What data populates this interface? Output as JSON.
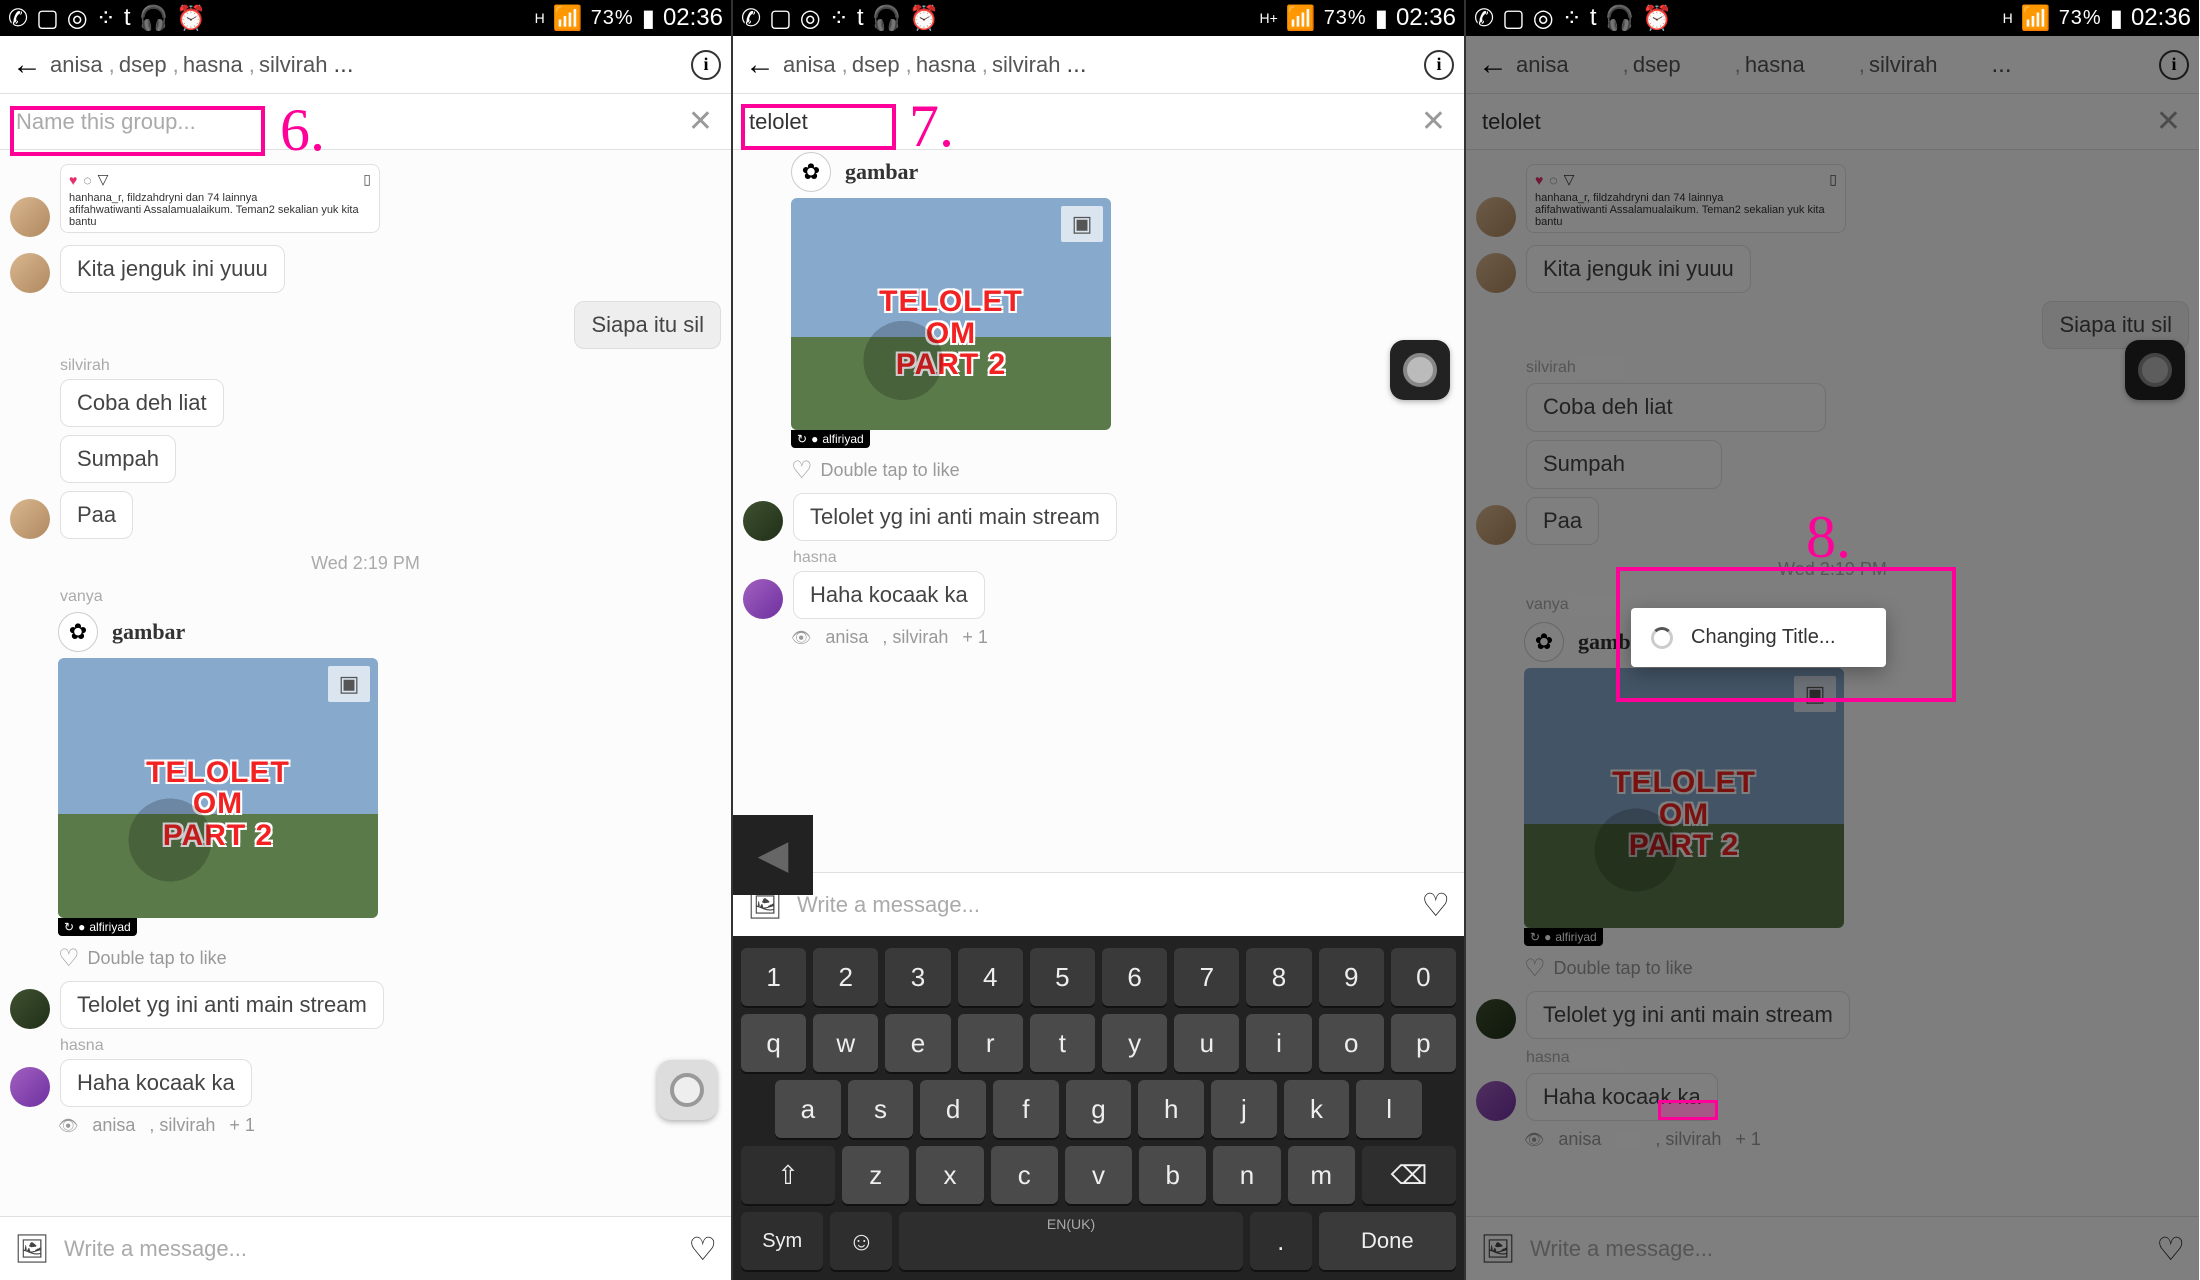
{
  "status_bar": {
    "net_label_h": "H",
    "net_label_hplus": "H+",
    "battery_pct": "73%",
    "time": "02:36"
  },
  "header": {
    "participants": [
      "anisa",
      "dsep",
      "hasna",
      "silvirah"
    ],
    "ellipsis": "..."
  },
  "groupname": {
    "placeholder": "Name this group...",
    "value_7": "telolet",
    "value_8": "telolet"
  },
  "messages": {
    "post_likes": "hanhana_r, fildzahdryni dan 74 lainnya",
    "post_caption": "afifahwatiwanti Assalamualaikum. Teman2 sekalian yuk kita bantu",
    "m1": "Kita jenguk ini yuuu",
    "m2": "Siapa itu sil",
    "sender_silvirah": "silvirah",
    "m3": "Coba deh liat",
    "m4": "Sumpah",
    "m5": "Paa",
    "ts": "Wed 2:19 PM",
    "sender_vanya": "vanya",
    "gambar": "gambar",
    "thumb_line1": "TELOLET OM",
    "thumb_line2": "PART 2",
    "repost": "alfiriyad",
    "dbl_tap": "Double tap to like",
    "m6": "Telolet yg ini anti main stream",
    "sender_hasna": "hasna",
    "m7": "Haha kocaak ka",
    "seen1": "anisa",
    "seen2": "silvirah",
    "seen_more": "+ 1"
  },
  "compose": {
    "placeholder": "Write a message..."
  },
  "keyboard": {
    "numbers": [
      "1",
      "2",
      "3",
      "4",
      "5",
      "6",
      "7",
      "8",
      "9",
      "0"
    ],
    "row1": [
      "q",
      "w",
      "e",
      "r",
      "t",
      "y",
      "u",
      "i",
      "o",
      "p"
    ],
    "row2": [
      "a",
      "s",
      "d",
      "f",
      "g",
      "h",
      "j",
      "k",
      "l"
    ],
    "row3": [
      "z",
      "x",
      "c",
      "v",
      "b",
      "n",
      "m"
    ],
    "shift": "⇧",
    "del": "⌫",
    "sym": "Sym",
    "lang": "EN(UK)",
    "done": "Done",
    "mic": "◀"
  },
  "modal": {
    "text": "Changing Title..."
  },
  "annotations": {
    "n6": "6.",
    "n7": "7.",
    "n8": "8."
  }
}
